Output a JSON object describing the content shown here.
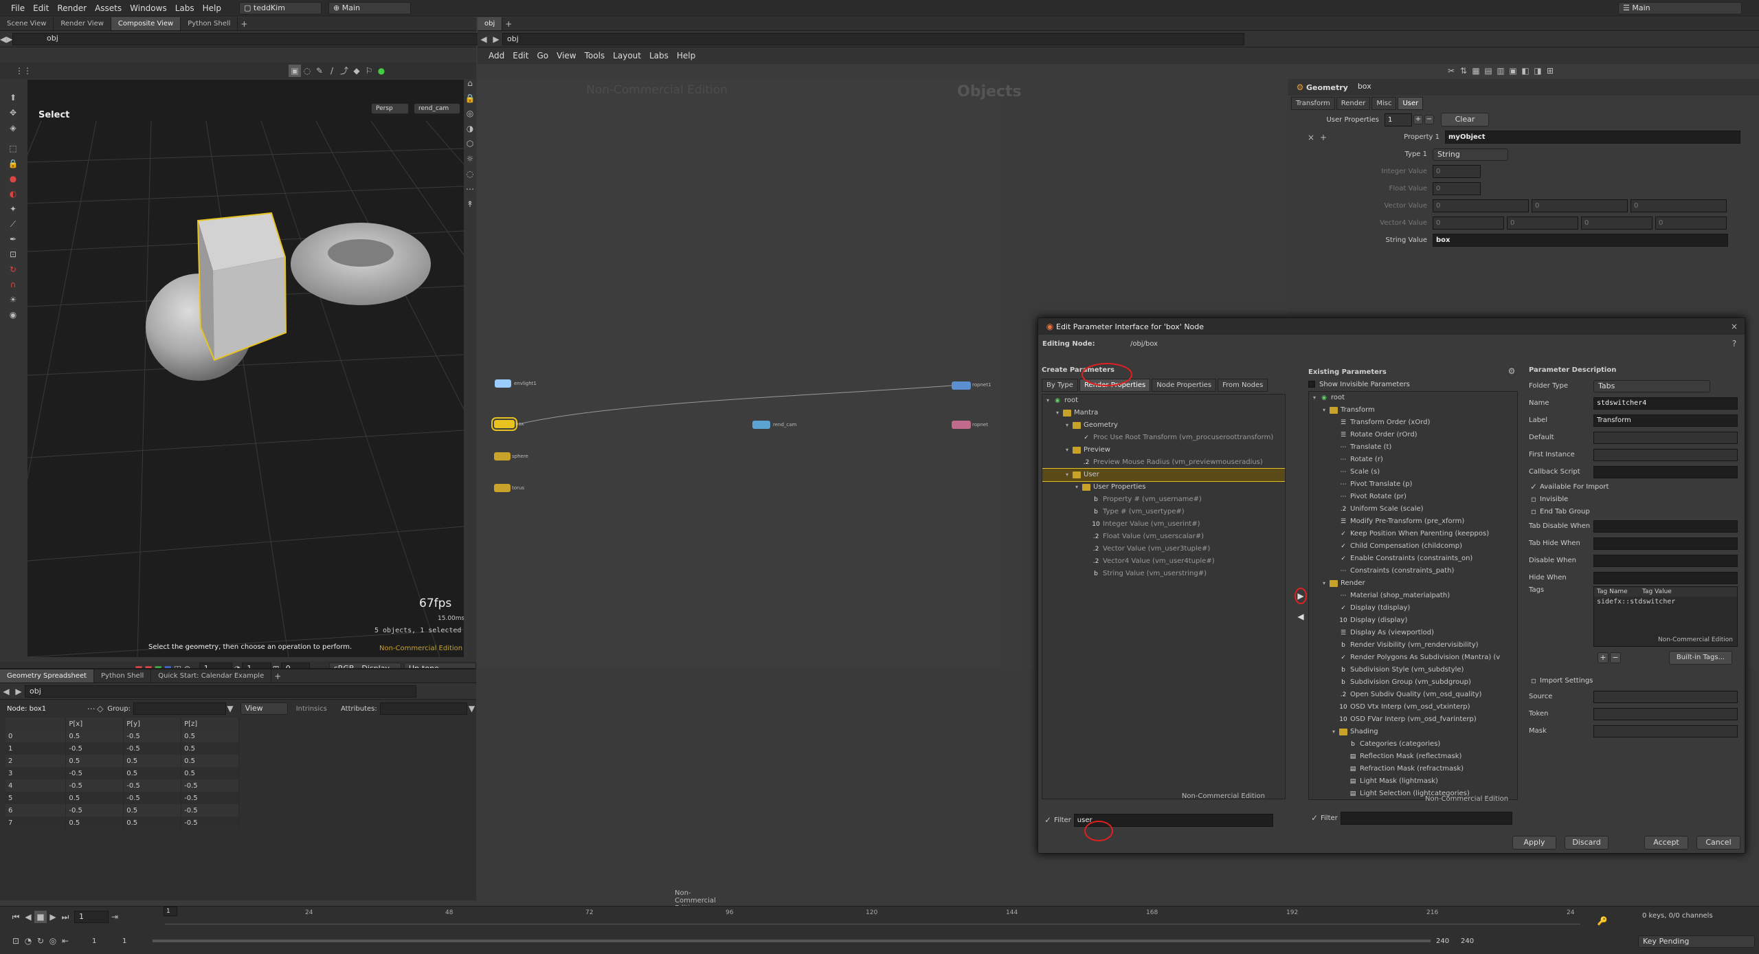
{
  "menubar": {
    "items": [
      "File",
      "Edit",
      "Render",
      "Assets",
      "Windows",
      "Labs",
      "Help"
    ],
    "desktop": "teddKim",
    "context": "Main",
    "right_context": "Main"
  },
  "viewer": {
    "tabs": [
      "Scene View",
      "Render View",
      "Composite View",
      "Python Shell"
    ],
    "active_tab": 2,
    "path": "obj",
    "tool_label": "Select",
    "camera_persp": "Persp",
    "camera_name": "rend_cam",
    "fps": "67fps",
    "frame_ms": "15.00ms",
    "selection_info": "5 objects, 1 selected",
    "status": "Select the geometry, then choose an operation to perform.",
    "watermark": "Non-Commercial Edition",
    "frame_a": "1",
    "frame_b": "1",
    "frame_c": "0",
    "colorspace": "sRGB - Display",
    "tonemap": "Un-tone-mapped"
  },
  "spreadsheet": {
    "tabs": [
      "Geometry Spreadsheet",
      "Python Shell",
      "Quick Start: Calendar Example"
    ],
    "path": "obj",
    "node": "Node: box1",
    "group_label": "Group:",
    "view_label": "View",
    "intrinsics_label": "Intrinsics",
    "attributes_label": "Attributes:",
    "columns": [
      "",
      "P[x]",
      "P[y]",
      "P[z]"
    ],
    "rows": [
      [
        "0",
        "0.5",
        "-0.5",
        "0.5"
      ],
      [
        "1",
        "-0.5",
        "-0.5",
        "0.5"
      ],
      [
        "2",
        "0.5",
        "0.5",
        "0.5"
      ],
      [
        "3",
        "-0.5",
        "0.5",
        "0.5"
      ],
      [
        "4",
        "-0.5",
        "-0.5",
        "-0.5"
      ],
      [
        "5",
        "0.5",
        "-0.5",
        "-0.5"
      ],
      [
        "6",
        "-0.5",
        "0.5",
        "-0.5"
      ],
      [
        "7",
        "0.5",
        "0.5",
        "-0.5"
      ]
    ],
    "watermark": "Non-Commercial Edition"
  },
  "network": {
    "tab": "obj",
    "path": "obj",
    "menu": [
      "Add",
      "Edit",
      "Go",
      "View",
      "Tools",
      "Layout",
      "Labs",
      "Help"
    ],
    "watermark": "Non-Commercial Edition",
    "context_label": "Objects",
    "nodes": [
      {
        "label": "envlight1"
      },
      {
        "label": "ropnet1"
      },
      {
        "label": "box"
      },
      {
        "label": "rend_cam"
      },
      {
        "label": "ropnet"
      },
      {
        "label": "sphere"
      },
      {
        "label": "torus"
      }
    ]
  },
  "params": {
    "type": "Geometry",
    "name": "box",
    "tabs": [
      "Transform",
      "Render",
      "Misc",
      "User"
    ],
    "active_tab": 3,
    "user_props_label": "User Properties",
    "user_props_count": "1",
    "clear_label": "Clear",
    "property1_label": "Property 1",
    "property1_value": "myObject",
    "type1_label": "Type 1",
    "type1_value": "String",
    "int_label": "Integer Value",
    "float_label": "Float Value",
    "vector_label": "Vector Value",
    "vector4_label": "Vector4 Value",
    "string_label": "String Value",
    "zero": "0",
    "string_value": "box"
  },
  "dialog": {
    "title": "Edit Parameter Interface for 'box' Node",
    "editing_label": "Editing Node:",
    "editing_path": "/obj/box",
    "create_title": "Create Parameters",
    "create_tabs": [
      "By Type",
      "Render Properties",
      "Node Properties",
      "From Nodes"
    ],
    "create_active": 1,
    "create_tree": [
      {
        "indent": 0,
        "kind": "root",
        "label": "root"
      },
      {
        "indent": 1,
        "kind": "folder",
        "label": "Mantra"
      },
      {
        "indent": 2,
        "kind": "folder",
        "label": "Geometry"
      },
      {
        "indent": 3,
        "kind": "check",
        "label": "Proc Use Root Transform (vm_procuseroottransform)"
      },
      {
        "indent": 2,
        "kind": "folder",
        "label": "Preview"
      },
      {
        "indent": 3,
        "kind": "float",
        "label": "Preview Mouse Radius (vm_previewmouseradius)"
      },
      {
        "indent": 2,
        "kind": "folder",
        "label": "User",
        "highlight": true
      },
      {
        "indent": 3,
        "kind": "folder",
        "label": "User Properties"
      },
      {
        "indent": 4,
        "kind": "string",
        "label": "Property # (vm_username#)"
      },
      {
        "indent": 4,
        "kind": "string",
        "label": "Type # (vm_usertype#)"
      },
      {
        "indent": 4,
        "kind": "int",
        "label": "Integer Value (vm_userint#)"
      },
      {
        "indent": 4,
        "kind": "float",
        "label": "Float Value (vm_userscalar#)"
      },
      {
        "indent": 4,
        "kind": "float",
        "label": "Vector Value (vm_user3tuple#)"
      },
      {
        "indent": 4,
        "kind": "float",
        "label": "Vector4 Value (vm_user4tuple#)"
      },
      {
        "indent": 4,
        "kind": "string",
        "label": "String Value (vm_userstring#)"
      }
    ],
    "create_watermark": "Non-Commercial Edition",
    "filter_label": "Filter",
    "filter_value": "user",
    "existing_title": "Existing Parameters",
    "show_invisible": "Show Invisible Parameters",
    "existing_tree": [
      {
        "indent": 0,
        "kind": "root",
        "label": "root"
      },
      {
        "indent": 1,
        "kind": "folder",
        "label": "Transform"
      },
      {
        "indent": 2,
        "kind": "menu",
        "label": "Transform Order (xOrd)"
      },
      {
        "indent": 2,
        "kind": "menu",
        "label": "Rotate Order (rOrd)"
      },
      {
        "indent": 2,
        "kind": "vec",
        "label": "Translate (t)"
      },
      {
        "indent": 2,
        "kind": "vec",
        "label": "Rotate (r)"
      },
      {
        "indent": 2,
        "kind": "vec",
        "label": "Scale (s)"
      },
      {
        "indent": 2,
        "kind": "vec",
        "label": "Pivot Translate (p)"
      },
      {
        "indent": 2,
        "kind": "vec",
        "label": "Pivot Rotate (pr)"
      },
      {
        "indent": 2,
        "kind": "float",
        "label": "Uniform Scale (scale)"
      },
      {
        "indent": 2,
        "kind": "menu",
        "label": "Modify Pre-Transform (pre_xform)"
      },
      {
        "indent": 2,
        "kind": "check",
        "label": "Keep Position When Parenting (keeppos)"
      },
      {
        "indent": 2,
        "kind": "check",
        "label": "Child Compensation (childcomp)"
      },
      {
        "indent": 2,
        "kind": "check",
        "label": "Enable Constraints (constraints_on)"
      },
      {
        "indent": 2,
        "kind": "vec",
        "label": "Constraints (constraints_path)"
      },
      {
        "indent": 1,
        "kind": "folder",
        "label": "Render"
      },
      {
        "indent": 2,
        "kind": "vec",
        "label": "Material (shop_materialpath)"
      },
      {
        "indent": 2,
        "kind": "check",
        "label": "Display (tdisplay)"
      },
      {
        "indent": 2,
        "kind": "int",
        "label": "Display (display)"
      },
      {
        "indent": 2,
        "kind": "menu",
        "label": "Display As (viewportlod)"
      },
      {
        "indent": 2,
        "kind": "string",
        "label": "Render Visibility (vm_rendervisibility)"
      },
      {
        "indent": 2,
        "kind": "check",
        "label": "Render Polygons As Subdivision (Mantra) (v"
      },
      {
        "indent": 2,
        "kind": "string",
        "label": "Subdivision Style (vm_subdstyle)"
      },
      {
        "indent": 2,
        "kind": "string",
        "label": "Subdivision Group (vm_subdgroup)"
      },
      {
        "indent": 2,
        "kind": "float",
        "label": "Open Subdiv Quality (vm_osd_quality)"
      },
      {
        "indent": 2,
        "kind": "int",
        "label": "OSD Vtx Interp (vm_osd_vtxinterp)"
      },
      {
        "indent": 2,
        "kind": "int",
        "label": "OSD FVar Interp (vm_osd_fvarinterp)"
      },
      {
        "indent": 2,
        "kind": "folder",
        "label": "Shading"
      },
      {
        "indent": 3,
        "kind": "string",
        "label": "Categories (categories)"
      },
      {
        "indent": 3,
        "kind": "op",
        "label": "Reflection Mask (reflectmask)"
      },
      {
        "indent": 3,
        "kind": "op",
        "label": "Refraction Mask (refractmask)"
      },
      {
        "indent": 3,
        "kind": "op",
        "label": "Light Mask (lightmask)"
      },
      {
        "indent": 3,
        "kind": "op",
        "label": "Light Selection (lightcategories)"
      }
    ],
    "existing_watermark": "Non-Commercial Edition",
    "desc_title": "Parameter Description",
    "folder_type_label": "Folder Type",
    "folder_type_value": "Tabs",
    "name_label": "Name",
    "name_value": "stdswitcher4",
    "label_label": "Label",
    "label_value": "Transform",
    "default_label": "Default",
    "first_instance_label": "First Instance",
    "callback_label": "Callback Script",
    "available_label": "Available For Import",
    "invisible_label": "Invisible",
    "end_tab_label": "End Tab Group",
    "tab_disable_label": "Tab Disable When",
    "tab_hide_label": "Tab Hide When",
    "disable_when_label": "Disable When",
    "hide_when_label": "Hide When",
    "tags_label": "Tags",
    "tag_name_col": "Tag Name",
    "tag_value_col": "Tag Value",
    "tag_row": "sidefx::stdswitcher",
    "desc_watermark": "Non-Commercial Edition",
    "builtin_tags": "Built-in Tags...",
    "import_settings": "Import Settings",
    "source_label": "Source",
    "token_label": "Token",
    "mask_label": "Mask",
    "buttons": {
      "apply": "Apply",
      "discard": "Discard",
      "accept": "Accept",
      "cancel": "Cancel"
    }
  },
  "timeline": {
    "frame": "1",
    "ticks": [
      "1",
      "24",
      "48",
      "72",
      "96",
      "120",
      "144",
      "168",
      "192",
      "216",
      "24"
    ],
    "start": "1",
    "start2": "1",
    "end": "240",
    "end2": "240",
    "keys_info": "0 keys, 0/0 channels",
    "key_pending": "Key Pending"
  },
  "colors": {
    "highlight_yellow": "#e8c320",
    "annotation_red": "#e02020",
    "folder": "#c9a22a"
  }
}
